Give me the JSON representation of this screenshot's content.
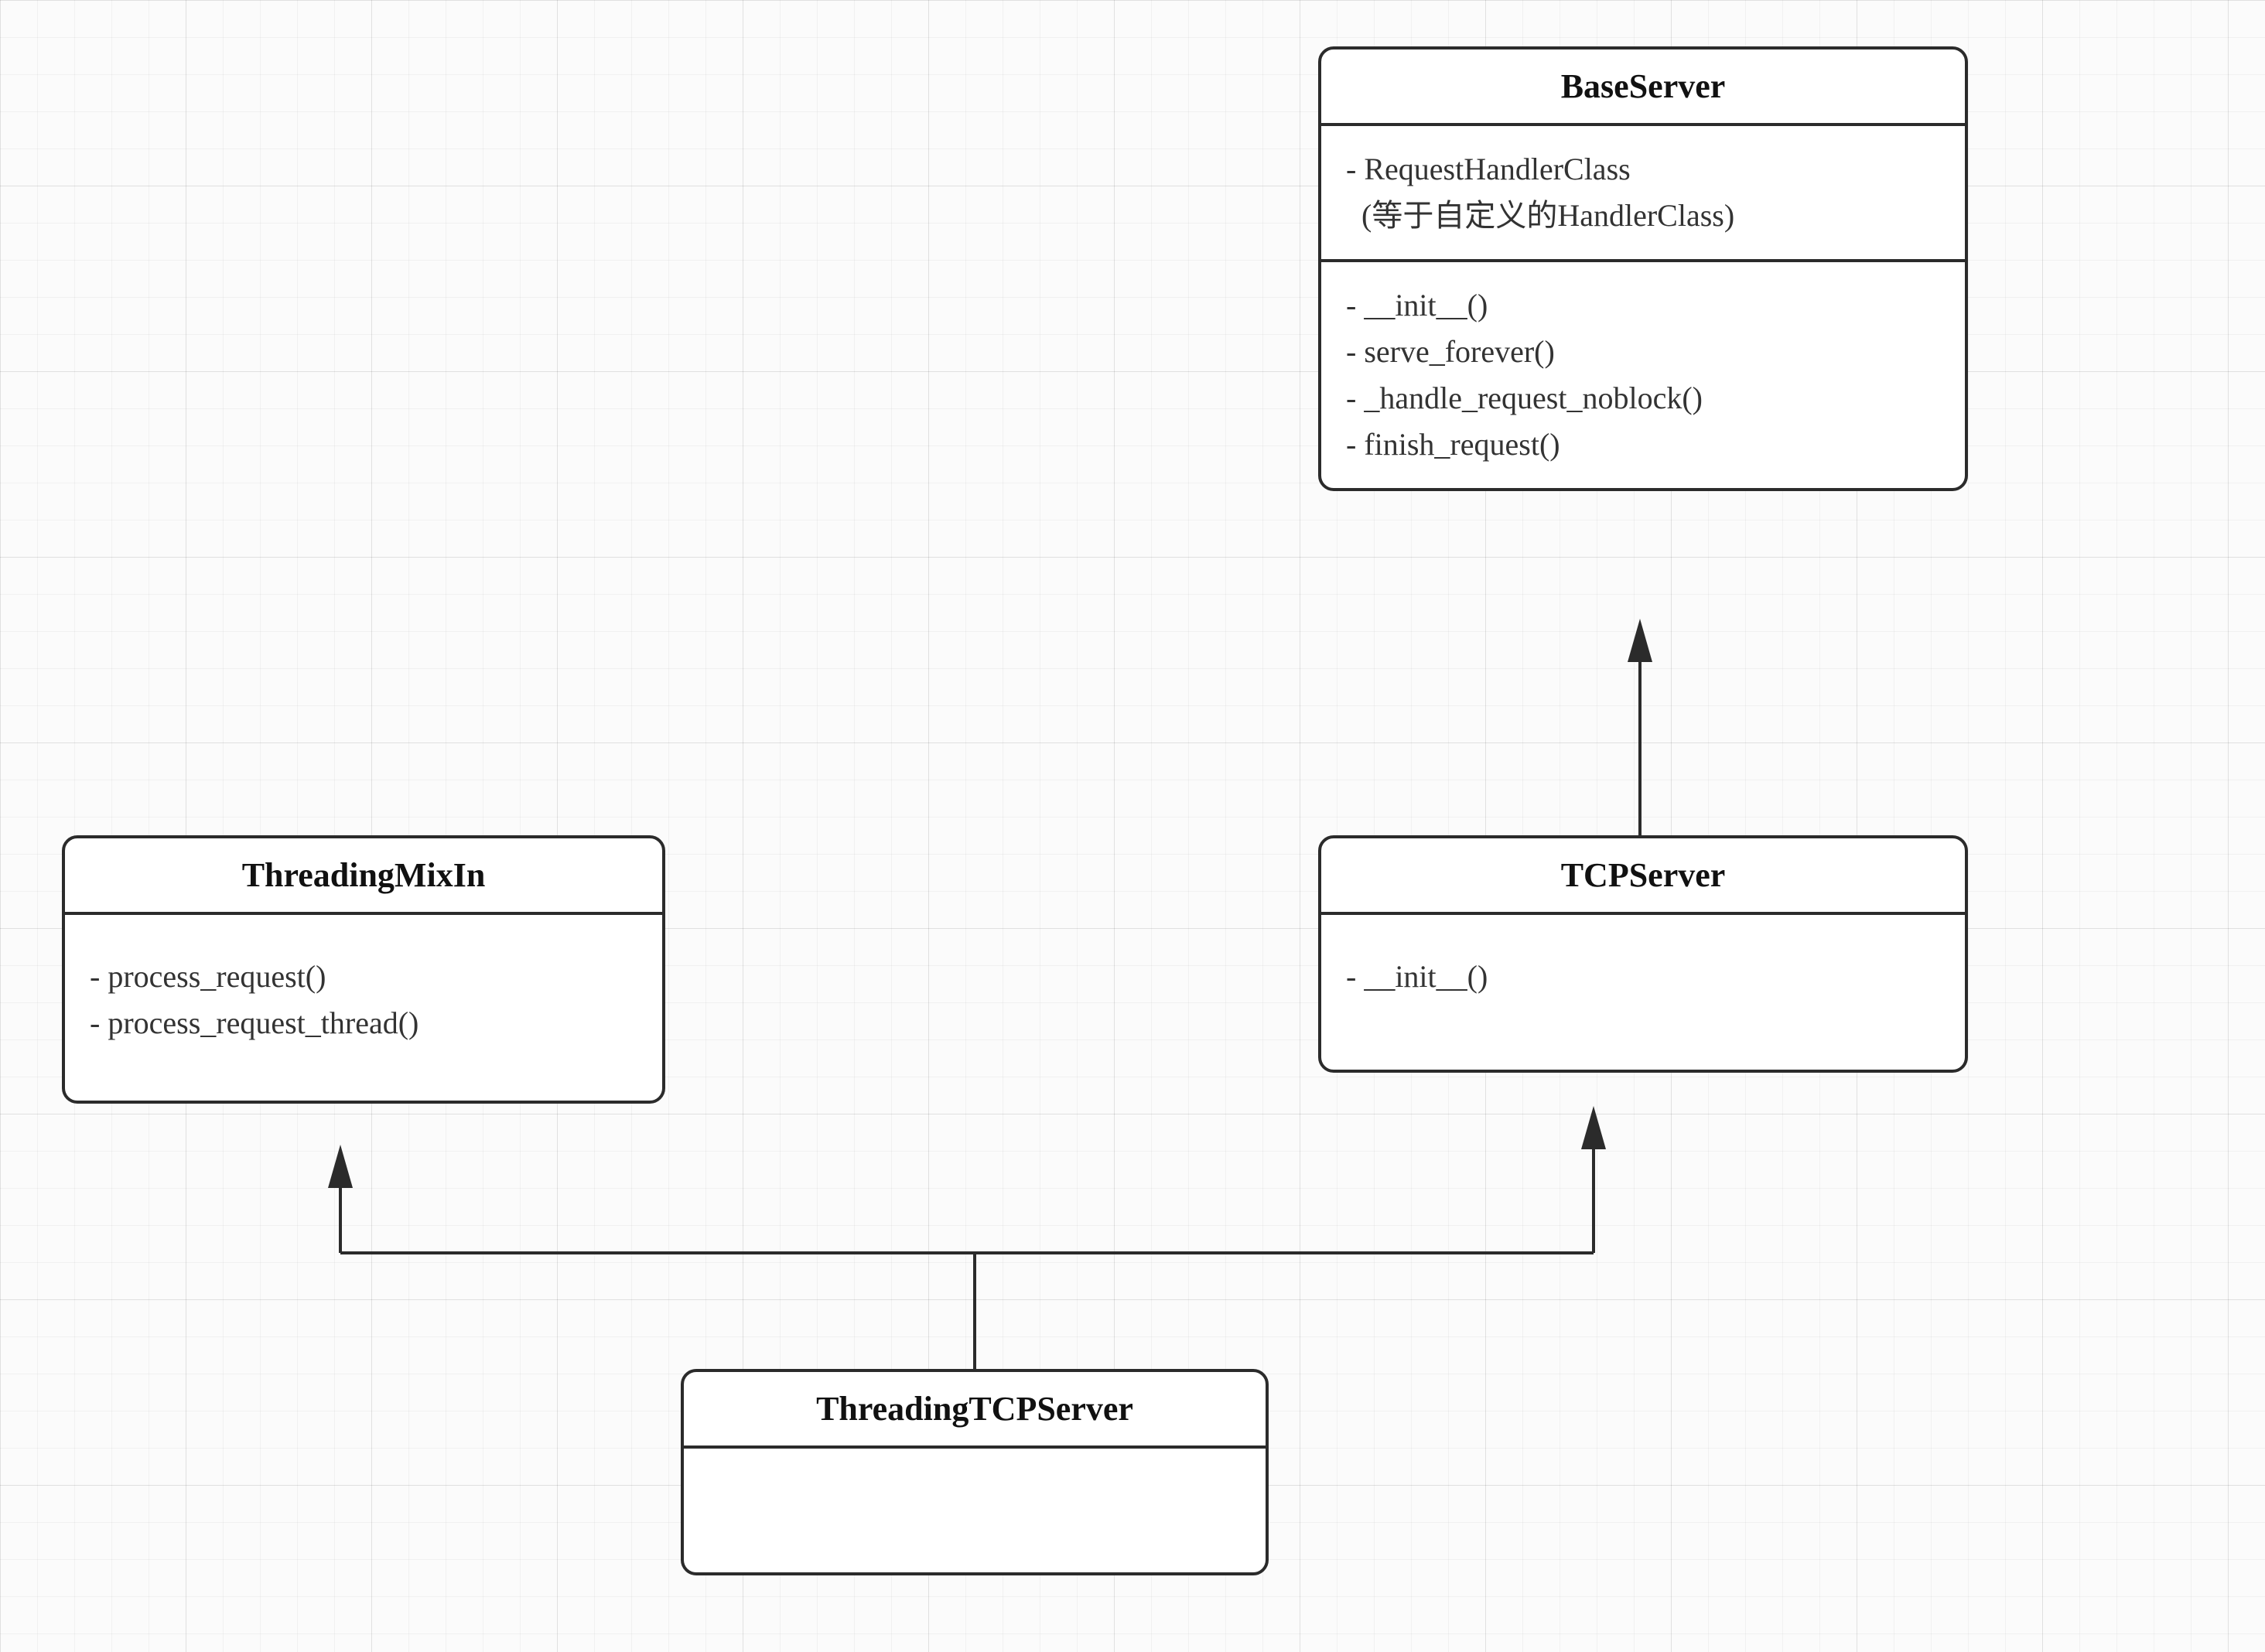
{
  "classes": {
    "baseServer": {
      "title": "BaseServer",
      "attributes": [
        "- RequestHandlerClass",
        "  (等于自定义的HandlerClass)"
      ],
      "methods": [
        "- __init__()",
        "- serve_forever()",
        "- _handle_request_noblock()",
        "- finish_request()"
      ]
    },
    "threadingMixIn": {
      "title": "ThreadingMixIn",
      "methods": [
        "- process_request()",
        "- process_request_thread()"
      ]
    },
    "tcpServer": {
      "title": "TCPServer",
      "methods": [
        "- __init__()"
      ]
    },
    "threadingTcpServer": {
      "title": "ThreadingTCPServer"
    }
  },
  "relations": [
    {
      "from": "TCPServer",
      "to": "BaseServer",
      "type": "inheritance"
    },
    {
      "from": "ThreadingTCPServer",
      "to": "ThreadingMixIn",
      "type": "inheritance"
    },
    {
      "from": "ThreadingTCPServer",
      "to": "TCPServer",
      "type": "inheritance"
    }
  ],
  "chart_data": {
    "type": "uml-class-diagram",
    "nodes": [
      {
        "id": "BaseServer",
        "attributes": [
          "RequestHandlerClass (等于自定义的HandlerClass)"
        ],
        "methods": [
          "__init__()",
          "serve_forever()",
          "_handle_request_noblock()",
          "finish_request()"
        ]
      },
      {
        "id": "ThreadingMixIn",
        "attributes": [],
        "methods": [
          "process_request()",
          "process_request_thread()"
        ]
      },
      {
        "id": "TCPServer",
        "attributes": [],
        "methods": [
          "__init__()"
        ]
      },
      {
        "id": "ThreadingTCPServer",
        "attributes": [],
        "methods": []
      }
    ],
    "edges": [
      {
        "from": "TCPServer",
        "to": "BaseServer",
        "relation": "inherits"
      },
      {
        "from": "ThreadingTCPServer",
        "to": "ThreadingMixIn",
        "relation": "inherits"
      },
      {
        "from": "ThreadingTCPServer",
        "to": "TCPServer",
        "relation": "inherits"
      }
    ]
  }
}
